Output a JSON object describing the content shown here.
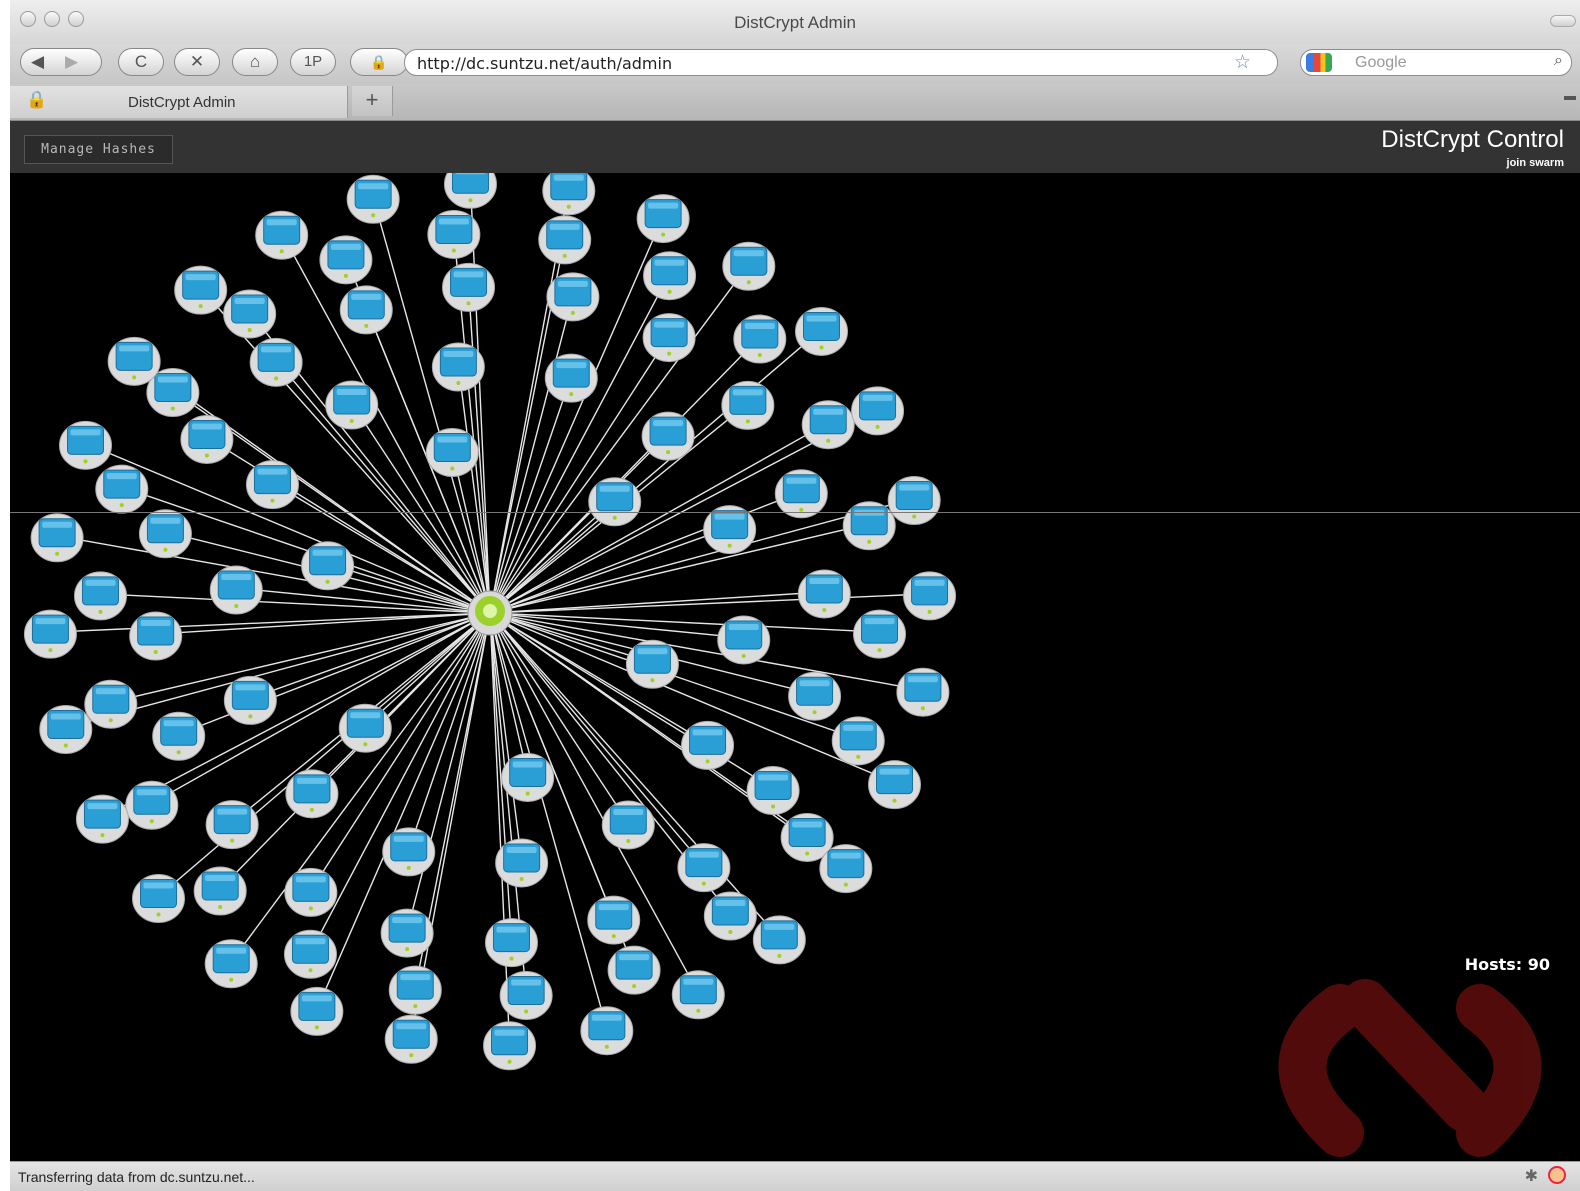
{
  "window": {
    "title": "DistCrypt Admin"
  },
  "toolbar": {
    "back_icon": "back-arrow-icon",
    "forward_icon": "forward-arrow-icon",
    "reload_label": "C",
    "stop_label": "✕",
    "home_icon": "home-icon",
    "onepassword_label": "1P",
    "url": "http://dc.suntzu.net/auth/admin",
    "search_placeholder": "Google"
  },
  "tabs": [
    {
      "label": "DistCrypt Admin"
    }
  ],
  "app": {
    "manage_label": "Manage Hashes",
    "brand": "DistCrypt Control",
    "join_label": "join swarm",
    "hosts_label": "Hosts: 90"
  },
  "graph": {
    "host_count": 90,
    "hub_icon": "gear-hub-icon",
    "node_icon": "imac-computer-icon",
    "accent": "#9bd12a",
    "screen_color": "#2a9fd6",
    "watermark_color": "#5a0d0d"
  },
  "status": {
    "text": "Transferring data from dc.suntzu.net..."
  }
}
